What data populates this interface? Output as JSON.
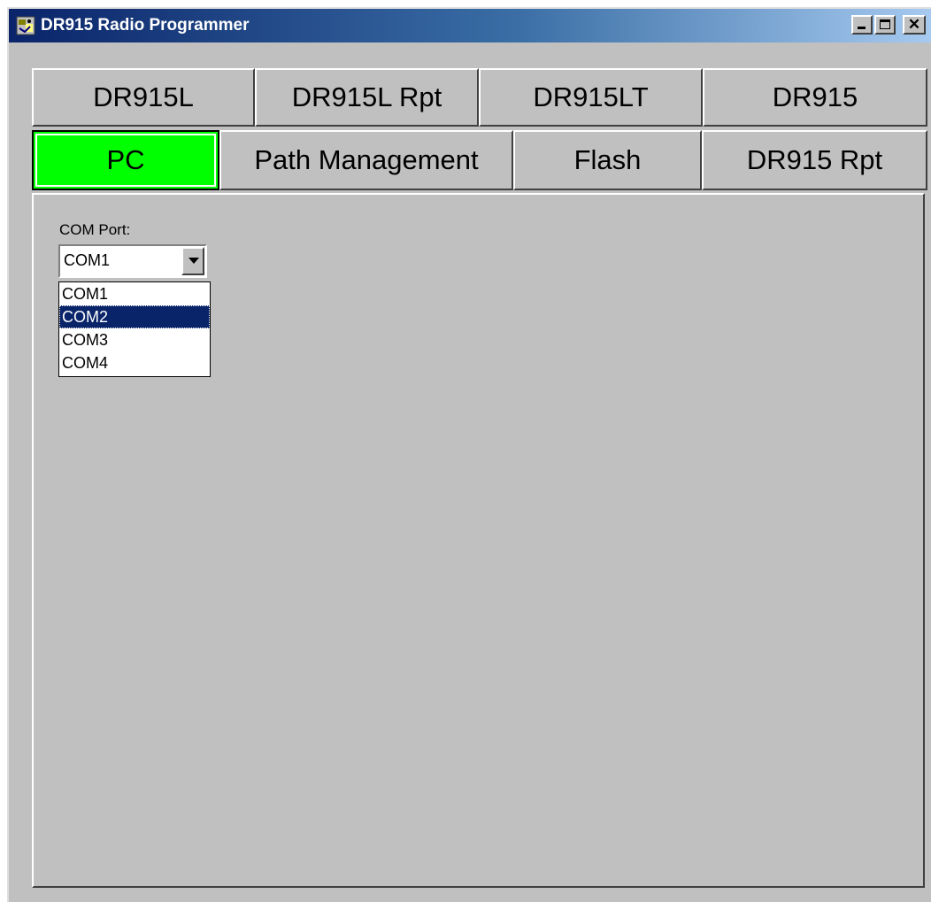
{
  "window": {
    "title": "DR915 Radio Programmer",
    "controls": {
      "minimize": "minimize",
      "maximize": "maximize",
      "close": "✕"
    }
  },
  "tabs": {
    "row1": [
      {
        "label": "DR915L",
        "active": false
      },
      {
        "label": "DR915L Rpt",
        "active": false
      },
      {
        "label": "DR915LT",
        "active": false
      },
      {
        "label": "DR915",
        "active": false
      }
    ],
    "row2": [
      {
        "label": "PC",
        "active": true
      },
      {
        "label": "Path Management",
        "active": false
      },
      {
        "label": "Flash",
        "active": false
      },
      {
        "label": "DR915 Rpt",
        "active": false
      }
    ]
  },
  "pc_panel": {
    "com_port_label": "COM Port:",
    "com_port_value": "COM1",
    "com_port_options": [
      "COM1",
      "COM2",
      "COM3",
      "COM4"
    ],
    "highlighted_option": "COM2"
  },
  "colors": {
    "active_tab": "#00ff00",
    "titlebar_start": "#0a246a",
    "titlebar_end": "#a6caf0",
    "highlight": "#0a246a",
    "face": "#c0c0c0"
  }
}
